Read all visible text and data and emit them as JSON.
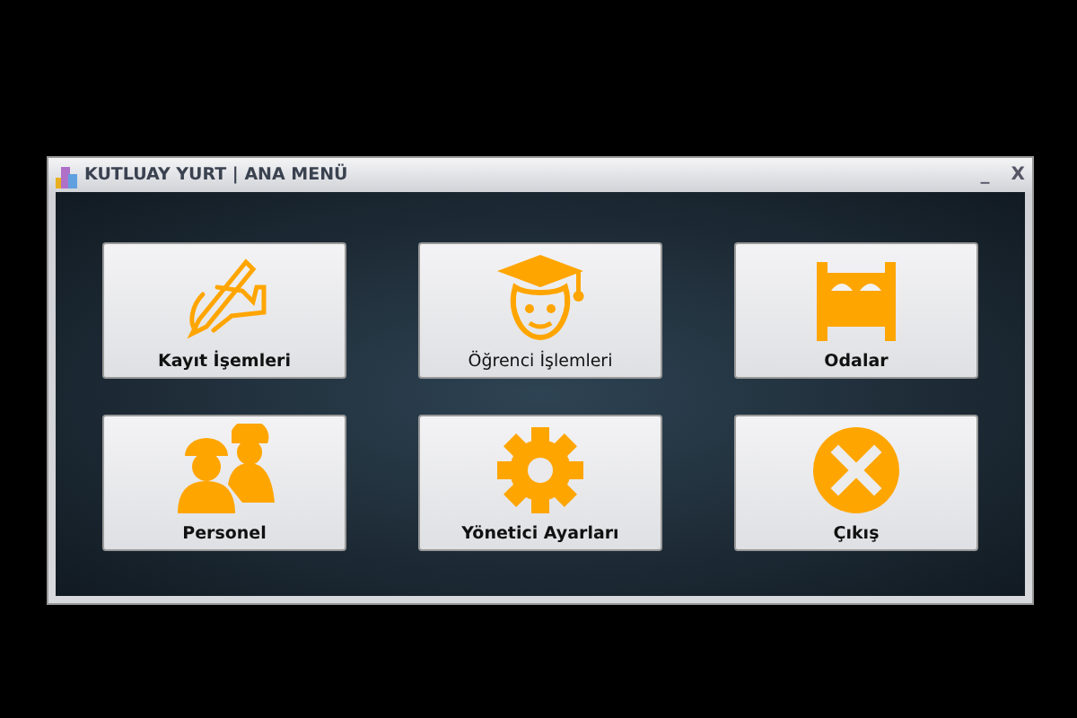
{
  "window": {
    "title": "KUTLUAY YURT | ANA MENÜ",
    "controls": [
      "_",
      "X"
    ]
  },
  "buttons": [
    {
      "label": "Kayıt İşemleri",
      "kind": "pen",
      "bold": true
    },
    {
      "label": "Öğrenci İşlemleri",
      "kind": "graduate",
      "bold": false
    },
    {
      "label": "Odalar",
      "kind": "bed",
      "bold": true
    },
    {
      "label": "Personel",
      "kind": "workers",
      "bold": true
    },
    {
      "label": "Yönetici Ayarları",
      "kind": "gear",
      "bold": true
    },
    {
      "label": "Çıkış",
      "kind": "close",
      "bold": true
    }
  ]
}
